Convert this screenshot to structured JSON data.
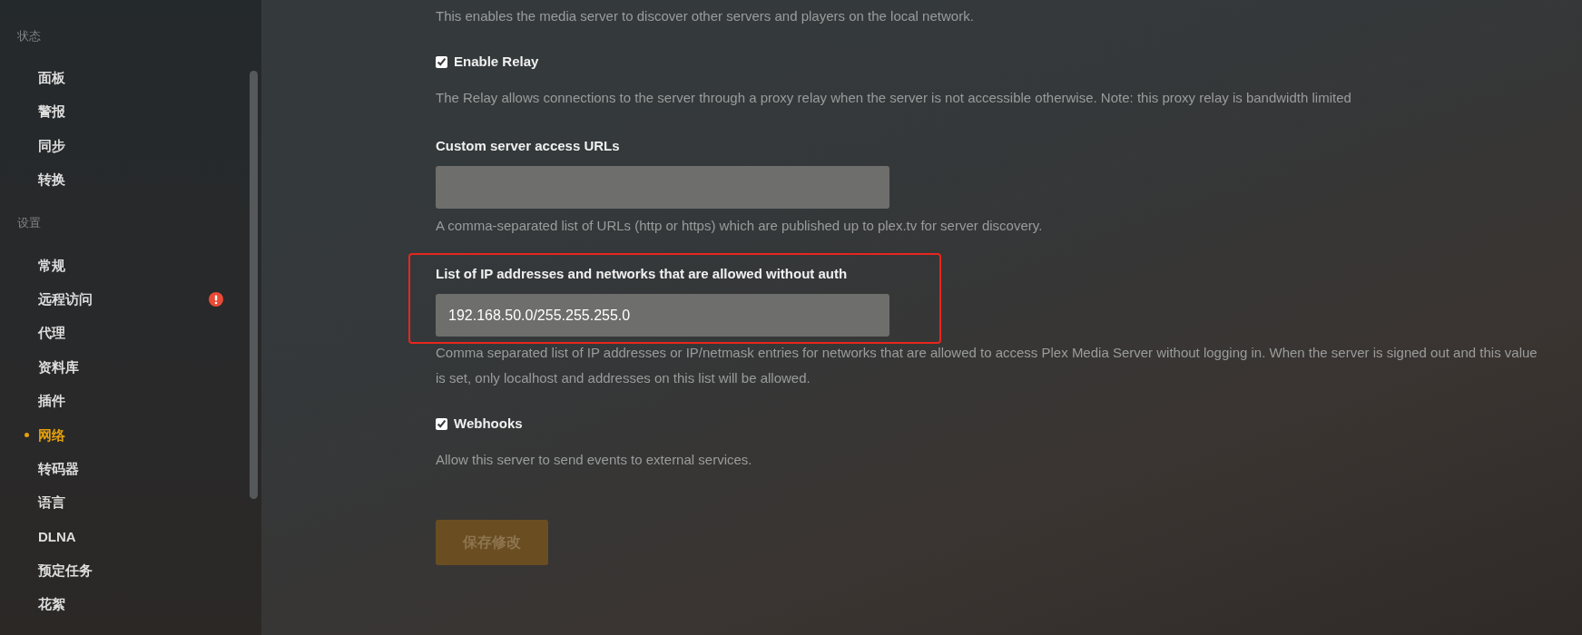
{
  "sidebar": {
    "sections": [
      {
        "header": "状态",
        "items": [
          {
            "label": "面板",
            "selected": false,
            "alert": false
          },
          {
            "label": "警报",
            "selected": false,
            "alert": false
          },
          {
            "label": "同步",
            "selected": false,
            "alert": false
          },
          {
            "label": "转换",
            "selected": false,
            "alert": false
          }
        ]
      },
      {
        "header": "设置",
        "items": [
          {
            "label": "常规",
            "selected": false,
            "alert": false
          },
          {
            "label": "远程访问",
            "selected": false,
            "alert": true
          },
          {
            "label": "代理",
            "selected": false,
            "alert": false
          },
          {
            "label": "资料库",
            "selected": false,
            "alert": false
          },
          {
            "label": "插件",
            "selected": false,
            "alert": false
          },
          {
            "label": "网络",
            "selected": true,
            "alert": false
          },
          {
            "label": "转码器",
            "selected": false,
            "alert": false
          },
          {
            "label": "语言",
            "selected": false,
            "alert": false
          },
          {
            "label": "DLNA",
            "selected": false,
            "alert": false
          },
          {
            "label": "预定任务",
            "selected": false,
            "alert": false
          },
          {
            "label": "花絮",
            "selected": false,
            "alert": false
          }
        ]
      }
    ]
  },
  "settings": [
    {
      "kind": "note",
      "description": "This enables the media server to discover other servers and players on the local network."
    },
    {
      "kind": "checkbox",
      "label": "Enable Relay",
      "checked": true,
      "description": "The Relay allows connections to the server through a proxy relay when the server is not accessible otherwise. Note: this proxy relay is bandwidth limited"
    },
    {
      "kind": "field",
      "label": "Custom server access URLs",
      "highlighted": false,
      "description": "A comma-separated list of URLs (http or https) which are published up to plex.tv for server discovery."
    },
    {
      "kind": "field",
      "label": "List of IP addresses and networks that are allowed without auth",
      "value": "192.168.50.0/255.255.255.0",
      "highlighted": true,
      "description": "Comma separated list of IP addresses or IP/netmask entries for networks that are allowed to access Plex Media Server without logging in. When the server is signed out and this value is set, only localhost and addresses on this list will be allowed."
    },
    {
      "kind": "checkbox",
      "label": "Webhooks",
      "checked": true,
      "description": "Allow this server to send events to external services."
    }
  ],
  "save_button": {
    "label": "保存修改",
    "disabled": true
  }
}
